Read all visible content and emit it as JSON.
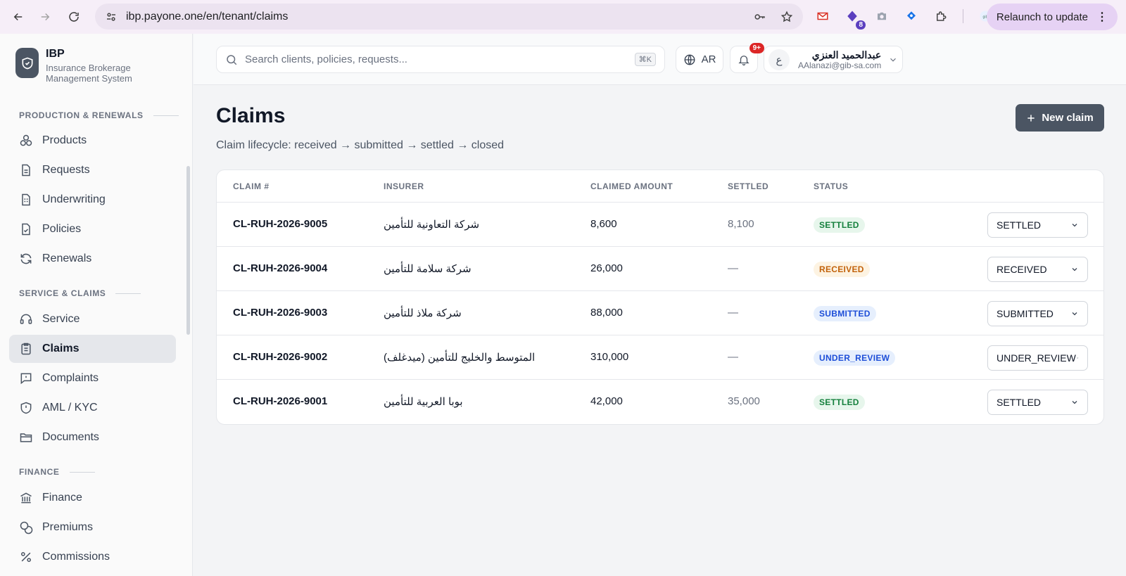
{
  "browser": {
    "url": "ibp.payone.one/en/tenant/claims",
    "relaunch_label": "Relaunch to update",
    "ext_badge": "8"
  },
  "brand": {
    "name": "IBP",
    "subtitle": "Insurance Brokerage Management System"
  },
  "sidebar": {
    "sections": [
      {
        "title": "PRODUCTION & RENEWALS"
      },
      {
        "title": "SERVICE & CLAIMS"
      },
      {
        "title": "FINANCE"
      }
    ],
    "items": [
      {
        "label": "Products",
        "icon": "boxes-icon"
      },
      {
        "label": "Requests",
        "icon": "document-icon"
      },
      {
        "label": "Underwriting",
        "icon": "clipboard-doc-icon"
      },
      {
        "label": "Policies",
        "icon": "file-check-icon"
      },
      {
        "label": "Renewals",
        "icon": "refresh-icon"
      },
      {
        "label": "Service",
        "icon": "headset-icon"
      },
      {
        "label": "Claims",
        "icon": "clipboard-list-icon",
        "active": true
      },
      {
        "label": "Complaints",
        "icon": "message-square-icon"
      },
      {
        "label": "AML / KYC",
        "icon": "shield-alert-icon"
      },
      {
        "label": "Documents",
        "icon": "folder-icon"
      },
      {
        "label": "Finance",
        "icon": "bank-icon"
      },
      {
        "label": "Premiums",
        "icon": "coins-icon"
      },
      {
        "label": "Commissions",
        "icon": "percent-icon"
      }
    ]
  },
  "topbar": {
    "search_placeholder": "Search clients, policies, requests...",
    "search_shortcut": "⌘K",
    "lang_label": "AR",
    "notif_count": "9+",
    "user_avatar": "ع",
    "user_name": "عبدالحميد العنزي",
    "user_email": "AAlanazi@gib-sa.com"
  },
  "page": {
    "title": "Claims",
    "subtitle": "Claim lifecycle: received → submitted → settled → closed",
    "new_button": "New claim"
  },
  "table": {
    "headers": [
      "CLAIM #",
      "INSURER",
      "CLAIMED AMOUNT",
      "SETTLED",
      "STATUS"
    ],
    "rows": [
      {
        "claim": "CL-RUH-2026-9005",
        "insurer": "شركة التعاونية للتأمين",
        "amount": "8,600",
        "settled": "8,100",
        "status": "SETTLED",
        "select": "SETTLED"
      },
      {
        "claim": "CL-RUH-2026-9004",
        "insurer": "شركة سلامة للتأمين",
        "amount": "26,000",
        "settled": "—",
        "status": "RECEIVED",
        "select": "RECEIVED"
      },
      {
        "claim": "CL-RUH-2026-9003",
        "insurer": "شركة ملاذ للتأمين",
        "amount": "88,000",
        "settled": "—",
        "status": "SUBMITTED",
        "select": "SUBMITTED"
      },
      {
        "claim": "CL-RUH-2026-9002",
        "insurer": "المتوسط والخليج للتأمين (ميدغلف)",
        "amount": "310,000",
        "settled": "—",
        "status": "UNDER_REVIEW",
        "select": "UNDER_REVIEW"
      },
      {
        "claim": "CL-RUH-2026-9001",
        "insurer": "بوبا العربية للتأمين",
        "amount": "42,000",
        "settled": "35,000",
        "status": "SETTLED",
        "select": "SETTLED"
      }
    ]
  },
  "status_colors": {
    "SETTLED": {
      "bg": "#e7f6ec",
      "fg": "#15803d"
    },
    "RECEIVED": {
      "bg": "#fdf3e2",
      "fg": "#c2620a"
    },
    "SUBMITTED": {
      "bg": "#e6effd",
      "fg": "#1d4ed8"
    },
    "UNDER_REVIEW": {
      "bg": "#e6effd",
      "fg": "#1d4ed8"
    }
  }
}
